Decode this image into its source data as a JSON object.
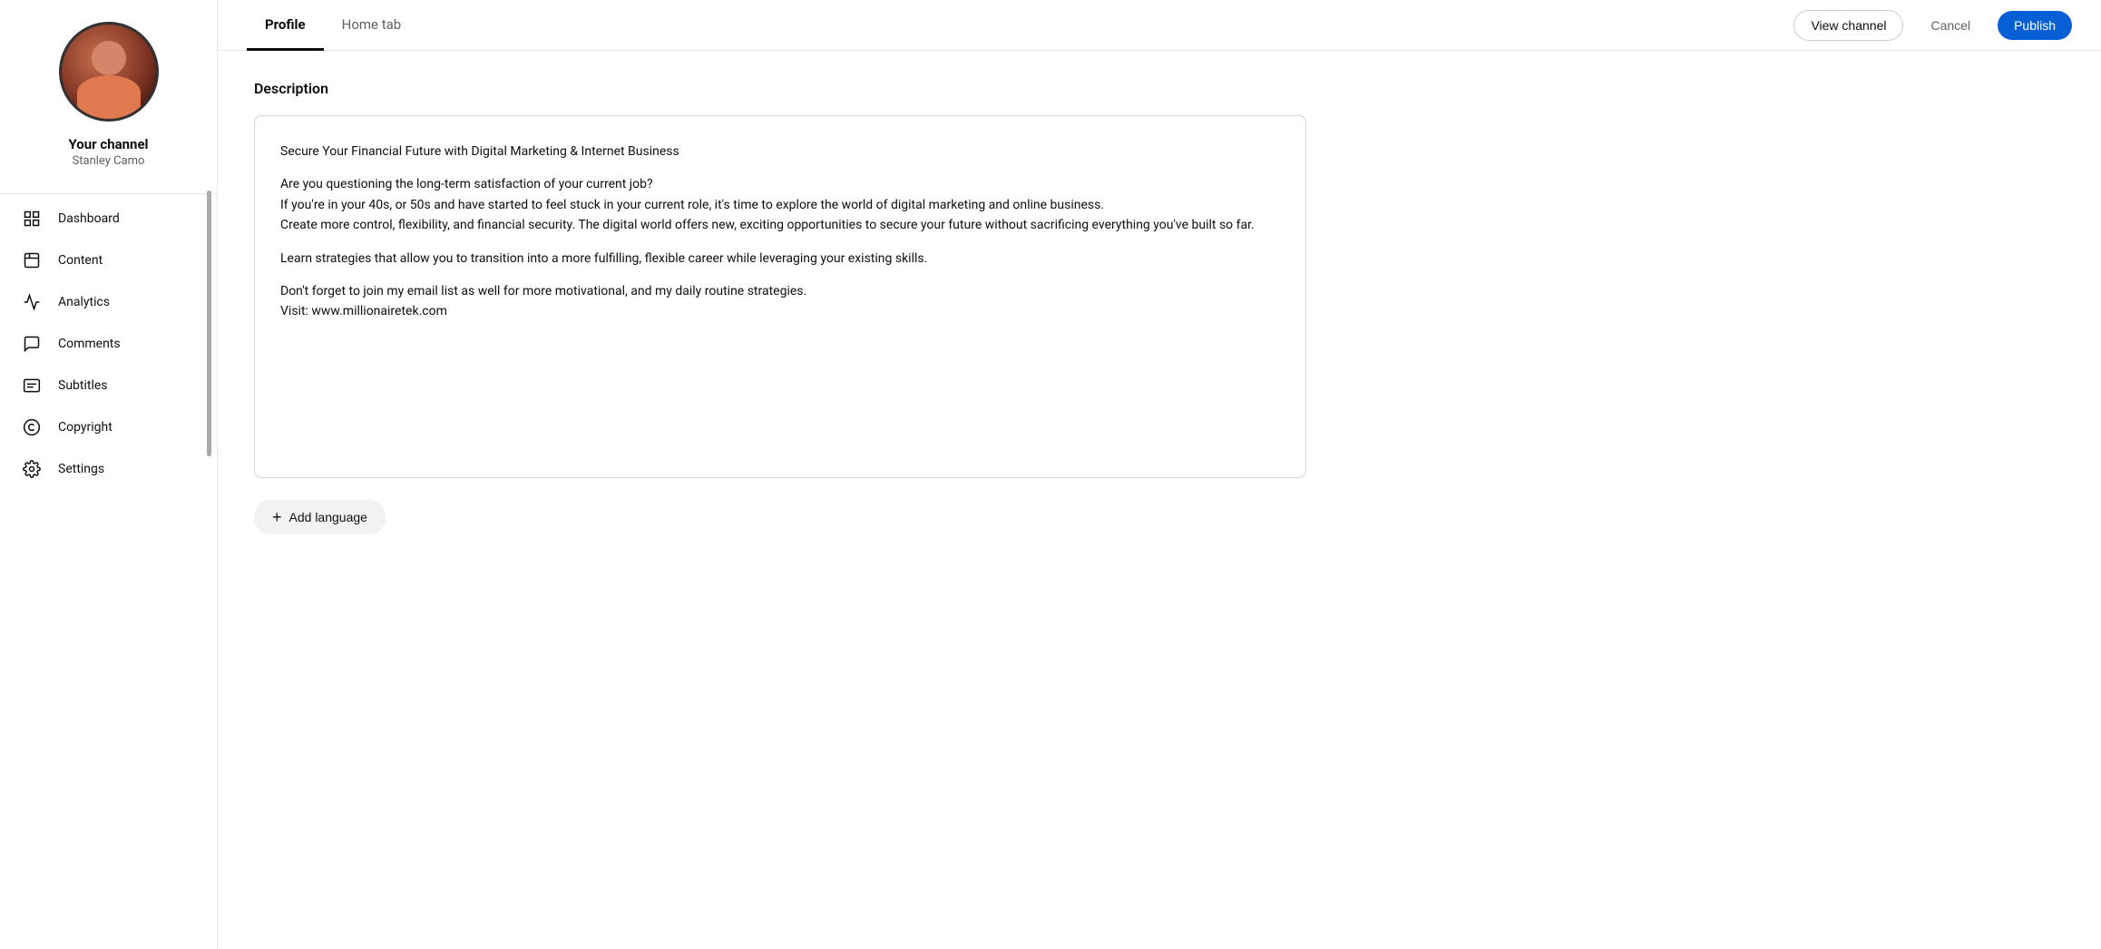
{
  "sidebar": {
    "channel_label": "Your channel",
    "channel_name": "Stanley Camo",
    "nav_items": [
      {
        "id": "dashboard",
        "label": "Dashboard",
        "icon": "dashboard"
      },
      {
        "id": "content",
        "label": "Content",
        "icon": "content"
      },
      {
        "id": "analytics",
        "label": "Analytics",
        "icon": "analytics"
      },
      {
        "id": "comments",
        "label": "Comments",
        "icon": "comments"
      },
      {
        "id": "subtitles",
        "label": "Subtitles",
        "icon": "subtitles"
      },
      {
        "id": "copyright",
        "label": "Copyright",
        "icon": "copyright"
      },
      {
        "id": "settings",
        "label": "Settings",
        "icon": "settings"
      }
    ]
  },
  "topbar": {
    "tabs": [
      {
        "id": "profile",
        "label": "Profile",
        "active": true
      },
      {
        "id": "home-tab",
        "label": "Home tab",
        "active": false
      }
    ],
    "btn_view_channel": "View channel",
    "btn_cancel": "Cancel",
    "btn_publish": "Publish"
  },
  "main": {
    "section_title": "Description",
    "description": "Secure Your Financial Future with Digital Marketing & Internet Business\n\nAre you questioning the long-term satisfaction of your current job?\nIf you're in your 40s, or 50s and have started to feel stuck in your current role, it's time to explore the world of digital marketing and online business.\nCreate more control, flexibility, and financial security. The digital world offers new, exciting opportunities to secure your future without sacrificing everything you've built so far.\n\n Learn strategies that allow you to transition into a more fulfilling, flexible career while leveraging your existing skills.\n\nDon't forget to join my email list as well for more motivational, and my daily routine strategies.\nVisit: www.millionairetek.com",
    "description_lines": [
      {
        "type": "text",
        "content": "Secure Your Financial Future with Digital Marketing & Internet Business"
      },
      {
        "type": "blank"
      },
      {
        "type": "text",
        "content": "Are you questioning the long-term satisfaction of your current job?"
      },
      {
        "type": "text",
        "content": "If you're in your 40s, or 50s and have started to feel stuck in your current role, it's time to explore the world of digital marketing and online business."
      },
      {
        "type": "text",
        "content": "Create more control, flexibility, and financial security. The digital world offers new, exciting opportunities to secure your future without sacrificing everything you've built so far."
      },
      {
        "type": "blank"
      },
      {
        "type": "text",
        "content": " Learn strategies that allow you to transition into a more fulfilling, flexible career while leveraging your existing skills."
      },
      {
        "type": "blank"
      },
      {
        "type": "text",
        "content": "Don't forget to join my email list as well for more motivational, and my daily routine strategies."
      },
      {
        "type": "text",
        "content": "Visit: www.millionairetek.com"
      }
    ],
    "add_language_label": "Add language"
  }
}
